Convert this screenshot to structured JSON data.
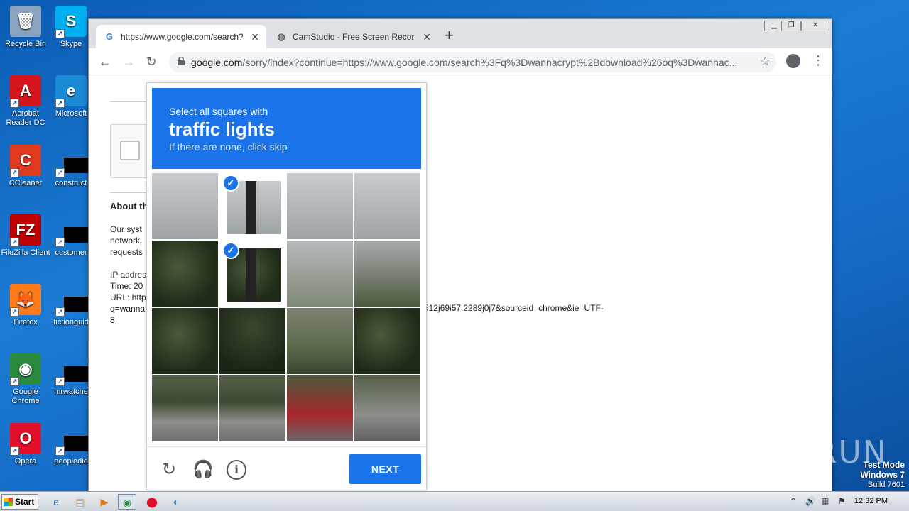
{
  "desktop": {
    "icons": [
      {
        "label": "Recycle Bin",
        "glyph": "🗑",
        "color": "#8aa4c0"
      },
      {
        "label": "Skype",
        "glyph": "S",
        "color": "#00aff0"
      },
      {
        "label": "Acrobat Reader DC",
        "glyph": "A",
        "color": "#d4161c"
      },
      {
        "label": "Microsoft",
        "glyph": "e",
        "color": "#1a8ad4"
      },
      {
        "label": "CCleaner",
        "glyph": "C",
        "color": "#e03a1e"
      },
      {
        "label": "construct",
        "glyph": "",
        "color": "#ffffff"
      },
      {
        "label": "FileZilla Client",
        "glyph": "FZ",
        "color": "#bf0000"
      },
      {
        "label": "customer",
        "glyph": "",
        "color": "#000000"
      },
      {
        "label": "Firefox",
        "glyph": "🦊",
        "color": "#ff7a18"
      },
      {
        "label": "fictionguid",
        "glyph": "",
        "color": "#000000"
      },
      {
        "label": "Google Chrome",
        "glyph": "◉",
        "color": "#2a8a3e"
      },
      {
        "label": "mrwatche",
        "glyph": "",
        "color": "#000000"
      },
      {
        "label": "Opera",
        "glyph": "O",
        "color": "#e0102b"
      },
      {
        "label": "peopledid",
        "glyph": "",
        "color": "#000000"
      }
    ]
  },
  "browser": {
    "tabs": [
      {
        "title": "https://www.google.com/search?q=",
        "favicon": "google-g-icon"
      },
      {
        "title": "CamStudio - Free Screen Recording",
        "favicon": "globe-icon"
      }
    ],
    "new_tab": "+",
    "url_host": "google.com",
    "url_rest": "/sorry/index?continue=https://www.google.com/search%3Fq%3Dwannacrypt%2Bdownload%26oq%3Dwannac..."
  },
  "page": {
    "about": "About th",
    "lines": [
      "Our syst",
      "network.",
      "requests",
      "",
      "IP addres",
      "Time: 20",
      "URL: http",
      "q=wanna",
      "8"
    ],
    "url_tail": "512j69i57.2289j0j7&sourceid=chrome&ie=UTF-"
  },
  "captcha": {
    "instruction": "Select all squares with",
    "target": "traffic lights",
    "hint": "If there are none, click skip",
    "selected_tiles": [
      1,
      5
    ],
    "next_label": "NEXT",
    "colors": {
      "accent": "#1a73e8"
    }
  },
  "watermark": {
    "brand": "ANY RUN",
    "mode": "Test Mode",
    "os": "Windows 7",
    "build": "Build 7601"
  },
  "taskbar": {
    "start_label": "Start",
    "clock": "12:32 PM"
  }
}
